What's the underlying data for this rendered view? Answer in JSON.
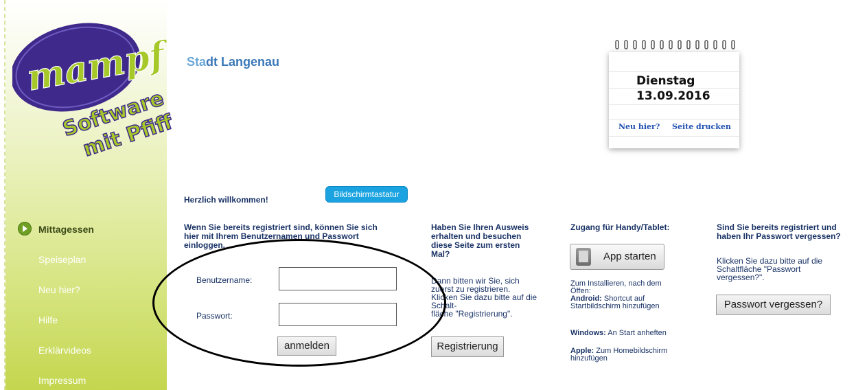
{
  "sidebar": {
    "logo": {
      "brand": "mampf",
      "tagline_line1": "Software",
      "tagline_line2": "mit Pfiff"
    },
    "items": [
      {
        "label": "Mittagessen",
        "active": true
      },
      {
        "label": "Speiseplan"
      },
      {
        "label": "Neu hier?"
      },
      {
        "label": "Hilfe"
      },
      {
        "label": "Erklärvideos"
      },
      {
        "label": "Impressum"
      }
    ]
  },
  "header": {
    "city_prefix": "Sta",
    "city_rest": "dt Langenau"
  },
  "calendar": {
    "day": "Dienstag",
    "date": "13.09.2016",
    "link_new": "Neu hier?",
    "link_print": "Seite drucken"
  },
  "welcome": "Herzlich willkommen!",
  "keyboard_button": "Bildschirmtastatur",
  "login": {
    "intro_line1": "Wenn Sie bereits registriert sind, können Sie sich",
    "intro_line2": "hier mit Ihrem Benutzernamen und Passwort",
    "intro_line3": "einloggen.",
    "username_label": "Benutzername:",
    "password_label": "Passwort:",
    "username_value": "",
    "password_value": "",
    "submit_label": "anmelden"
  },
  "register": {
    "head_lines": [
      "Haben Sie Ihren Ausweis",
      "erhalten und besuchen",
      "diese Seite zum ersten",
      "Mal?"
    ],
    "text_lines": [
      "Dann bitten wir Sie, sich",
      "zuerst zu registrieren.",
      "Klicken Sie dazu bitte auf die",
      "Schalt-",
      "fläche \"Registrierung\"."
    ],
    "button_label": "Registrierung"
  },
  "mobile": {
    "head": "Zugang für Handy/Tablet:",
    "app_button": "App starten",
    "install_lines": [
      "Zum Installieren, nach dem",
      "Öffen:"
    ],
    "android_label": "Android:",
    "android_text1": "Shortcut auf",
    "android_text2": "Startbildschirm hinzufügen",
    "windows_label": "Windows:",
    "windows_text": "An Start anheften",
    "apple_label": "Apple:",
    "apple_text1": "Zum Homebildschirm",
    "apple_text2": "hinzufügen"
  },
  "forgot": {
    "head_lines": [
      "Sind Sie bereits registriert und",
      "haben Ihr Passwort vergessen?"
    ],
    "text_lines": [
      "Klicken Sie dazu bitte auf die",
      "Schaltfläche \"Passwort",
      "vergessen?\"."
    ],
    "button_label": "Passwort vergessen?"
  },
  "colors": {
    "nav_active": "#3a4a16",
    "heading_blue": "#1a3366",
    "city_blue": "#3a78b8",
    "keyboard_button_bg": "#1aa3e0",
    "logo_purple": "#3f2a8c",
    "logo_green": "#a6c828"
  }
}
